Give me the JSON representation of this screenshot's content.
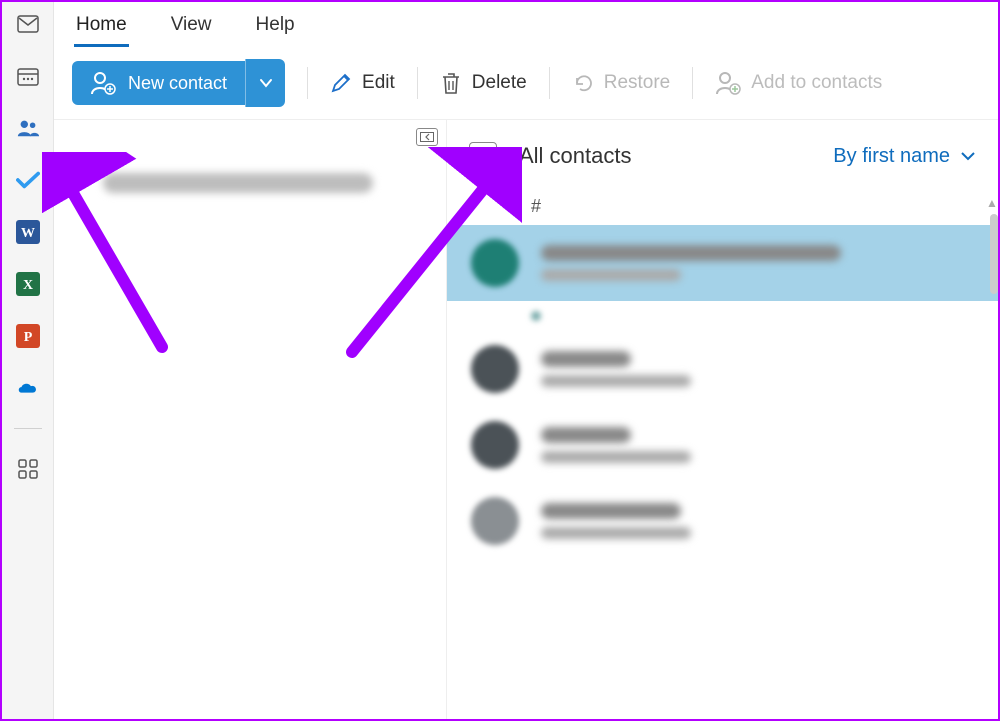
{
  "tabs": {
    "home": "Home",
    "view": "View",
    "help": "Help"
  },
  "toolbar": {
    "new_contact": "New contact",
    "edit": "Edit",
    "delete": "Delete",
    "restore": "Restore",
    "add_to_contacts": "Add to contacts"
  },
  "folder": {
    "account_label": "(redacted account email)"
  },
  "list": {
    "title": "All contacts",
    "sort": "By first name",
    "group_hash": "#"
  },
  "contacts": [
    {
      "name": "(redacted)",
      "sub": "(redacted)",
      "avatar_color": "teal",
      "selected": true,
      "name_w": 300,
      "sub_w": 140
    },
    {
      "name": "(redacted)",
      "sub": "(redacted)",
      "avatar_color": "dark",
      "selected": false,
      "name_w": 90,
      "sub_w": 150
    },
    {
      "name": "(redacted)",
      "sub": "(redacted)",
      "avatar_color": "dark",
      "selected": false,
      "name_w": 90,
      "sub_w": 150
    },
    {
      "name": "(redacted)",
      "sub": "(redacted)",
      "avatar_color": "grey",
      "selected": false,
      "name_w": 140,
      "sub_w": 150
    }
  ],
  "rail_icons": [
    "mail-icon",
    "calendar-icon",
    "people-icon",
    "todo-icon",
    "word-icon",
    "excel-icon",
    "powerpoint-icon",
    "onedrive-icon",
    "more-apps-icon"
  ],
  "colors": {
    "accent": "#0f6cbd",
    "primary_button": "#2e92d6",
    "word": "#2b579a",
    "excel": "#217346",
    "powerpoint": "#d24726",
    "onedrive": "#0078d4",
    "todo": "#2f9bf0",
    "people": "#2e6fbf"
  }
}
